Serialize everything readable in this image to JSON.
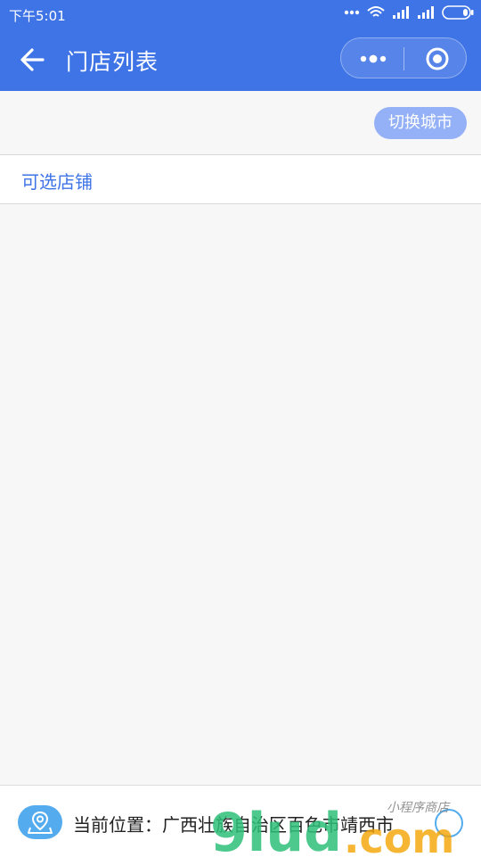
{
  "status_bar": {
    "time": "下午5:01",
    "icons": [
      "more-dots-icon",
      "wifi-icon",
      "signal-icon",
      "signal-icon",
      "battery-icon"
    ]
  },
  "nav": {
    "title": "门店列表",
    "back_icon": "arrow-left-icon",
    "more_icon": "more-dots-icon",
    "close_icon": "target-close-icon",
    "color": "#3f74e6"
  },
  "toolbar": {
    "switch_city_label": "切换城市"
  },
  "section": {
    "title": "可选店铺"
  },
  "stores": [],
  "location": {
    "icon": "map-pin-icon",
    "text": "当前位置：广西壮族自治区百色市靖西市",
    "refresh_icon": "refresh-icon"
  },
  "watermark": {
    "text": "9lud.com",
    "subtext": "小程序商店"
  },
  "colors": {
    "primary": "#3f74e6",
    "button_light": "#94b0f6",
    "location_blue": "#54acef",
    "watermark_green": "#2fc07a",
    "watermark_orange": "#f4a300"
  }
}
